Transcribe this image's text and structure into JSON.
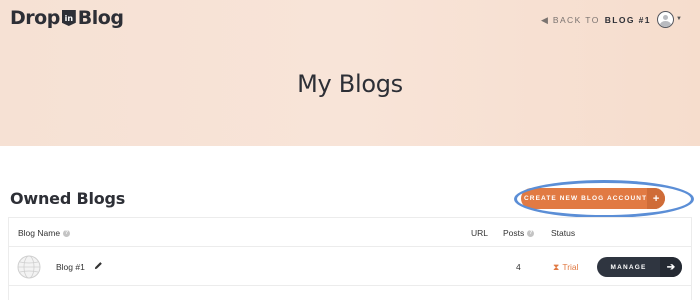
{
  "header": {
    "logo": {
      "left": "Drop",
      "badge": "in",
      "right": "Blog"
    },
    "back_link": {
      "prefix": "BACK TO",
      "target": "BLOG #1"
    },
    "page_title": "My Blogs"
  },
  "owned": {
    "title": "Owned Blogs",
    "create_button": "CREATE NEW BLOG ACCOUNT",
    "create_plus": "+",
    "highlight_color": "#5b8ed6"
  },
  "table": {
    "columns": {
      "blog_name": "Blog Name",
      "url": "URL",
      "posts": "Posts",
      "status": "Status"
    },
    "rows": [
      {
        "name": "Blog #1",
        "posts": "4",
        "status": "Trial",
        "action": "MANAGE"
      }
    ]
  },
  "icons": {
    "back": "arrow-left-icon",
    "user": "user-avatar-icon",
    "help": "question-circle-icon",
    "globe": "globe-icon",
    "edit": "pencil-icon",
    "trial": "hourglass-icon",
    "manage": "arrow-right-icon"
  },
  "colors": {
    "accent": "#e17a43",
    "dark": "#2f3540",
    "hero": "#f7e2d6"
  }
}
